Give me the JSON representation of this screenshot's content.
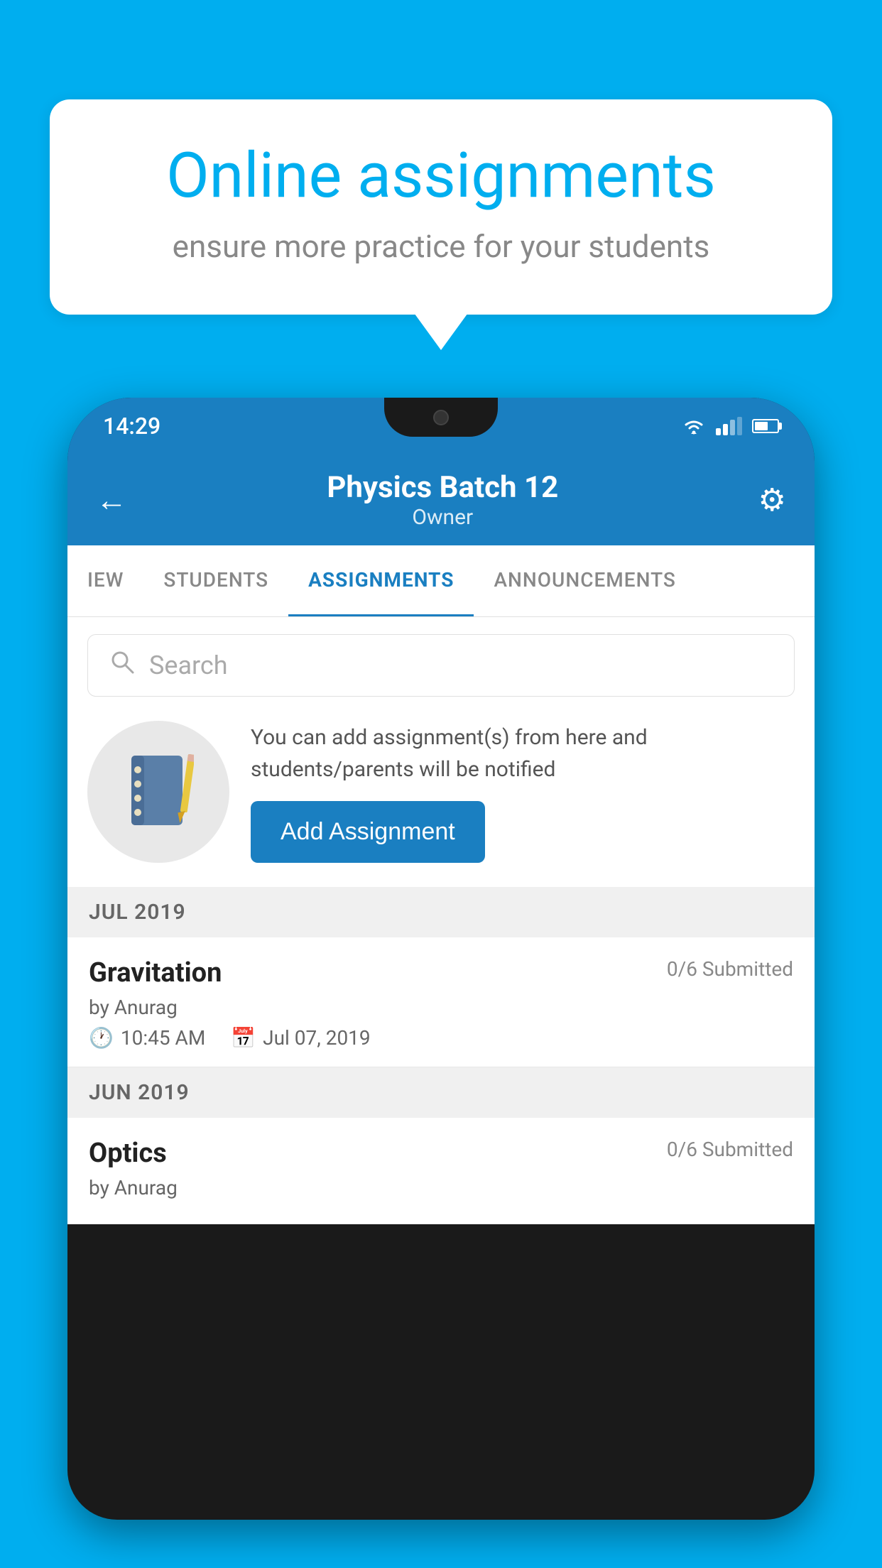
{
  "background_color": "#00AEEF",
  "speech_bubble": {
    "title": "Online assignments",
    "subtitle": "ensure more practice for your students"
  },
  "phone": {
    "status_bar": {
      "time": "14:29"
    },
    "header": {
      "title": "Physics Batch 12",
      "subtitle": "Owner",
      "back_label": "←",
      "settings_label": "⚙"
    },
    "tabs": [
      {
        "label": "IEW",
        "active": false
      },
      {
        "label": "STUDENTS",
        "active": false
      },
      {
        "label": "ASSIGNMENTS",
        "active": true
      },
      {
        "label": "ANNOUNCEMENTS",
        "active": false
      }
    ],
    "search": {
      "placeholder": "Search"
    },
    "promo": {
      "description": "You can add assignment(s) from here and students/parents will be notified",
      "add_button_label": "Add Assignment"
    },
    "sections": [
      {
        "label": "JUL 2019",
        "assignments": [
          {
            "title": "Gravitation",
            "submitted": "0/6 Submitted",
            "by": "by Anurag",
            "time": "10:45 AM",
            "date": "Jul 07, 2019"
          }
        ]
      },
      {
        "label": "JUN 2019",
        "assignments": [
          {
            "title": "Optics",
            "submitted": "0/6 Submitted",
            "by": "by Anurag",
            "time": "",
            "date": ""
          }
        ]
      }
    ]
  }
}
